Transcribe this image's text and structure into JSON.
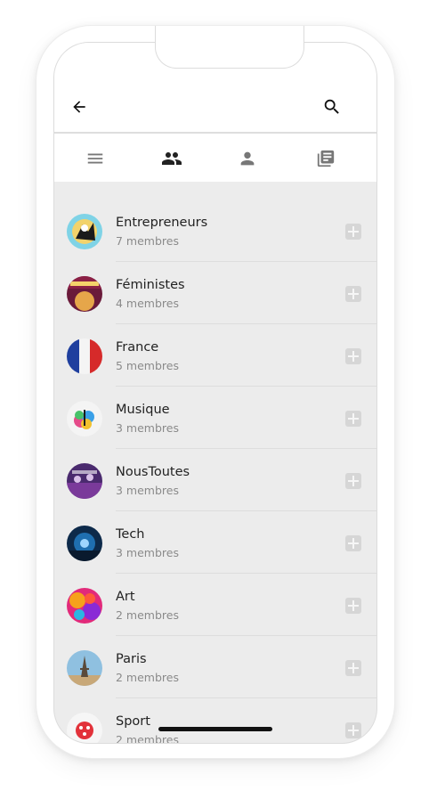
{
  "header": {
    "back_icon": "arrow-back-icon",
    "search_icon": "search-icon"
  },
  "tabs": [
    {
      "icon": "menu-icon",
      "color": "#777777"
    },
    {
      "icon": "groups-icon",
      "color": "#222222",
      "active": true
    },
    {
      "icon": "person-icon",
      "color": "#777777"
    },
    {
      "icon": "library-books-icon",
      "color": "#777777"
    }
  ],
  "groups": [
    {
      "name": "Entrepreneurs",
      "members": "7 membres"
    },
    {
      "name": "Féministes",
      "members": "4 membres"
    },
    {
      "name": "France",
      "members": "5 membres"
    },
    {
      "name": "Musique",
      "members": "3 membres"
    },
    {
      "name": "NousToutes",
      "members": "3 membres"
    },
    {
      "name": "Tech",
      "members": "3 membres"
    },
    {
      "name": "Art",
      "members": "2 membres"
    },
    {
      "name": "Paris",
      "members": "2 membres"
    },
    {
      "name": "Sport",
      "members": "2 membres"
    }
  ],
  "colors": {
    "screen_bg": "#ececec",
    "add_button": "#d6d6d6",
    "text_primary": "#222222",
    "text_secondary": "#8a8a8a"
  }
}
